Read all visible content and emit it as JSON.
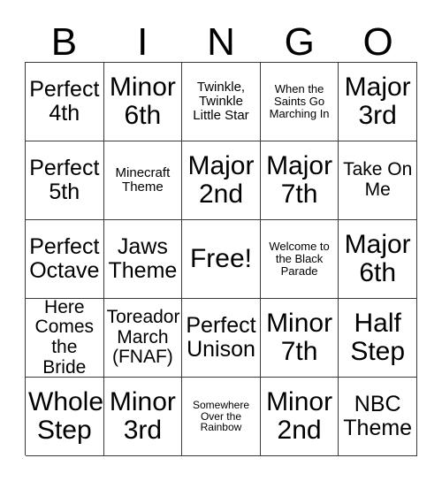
{
  "header": {
    "letters": [
      "B",
      "I",
      "N",
      "G",
      "O"
    ]
  },
  "grid": {
    "columns": 5,
    "rows": 5,
    "cells": [
      [
        {
          "text": "Perfect 4th",
          "size": "lg"
        },
        {
          "text": "Minor 6th",
          "size": "xl"
        },
        {
          "text": "Twinkle, Twinkle Little Star",
          "size": "sm"
        },
        {
          "text": "When the Saints Go Marching In",
          "size": "xs"
        },
        {
          "text": "Major 3rd",
          "size": "xl"
        }
      ],
      [
        {
          "text": "Perfect 5th",
          "size": "lg"
        },
        {
          "text": "Minecraft Theme",
          "size": "sm"
        },
        {
          "text": "Major 2nd",
          "size": "xl"
        },
        {
          "text": "Major 7th",
          "size": "xl"
        },
        {
          "text": "Take On Me",
          "size": "md"
        }
      ],
      [
        {
          "text": "Perfect Octave",
          "size": "lg"
        },
        {
          "text": "Jaws Theme",
          "size": "lg"
        },
        {
          "text": "Free!",
          "size": "xl"
        },
        {
          "text": "Welcome to the Black Parade",
          "size": "xs"
        },
        {
          "text": "Major 6th",
          "size": "xl"
        }
      ],
      [
        {
          "text": "Here Comes the Bride",
          "size": "md"
        },
        {
          "text": "Toreador March (FNAF)",
          "size": "md"
        },
        {
          "text": "Perfect Unison",
          "size": "lg"
        },
        {
          "text": "Minor 7th",
          "size": "xl"
        },
        {
          "text": "Half Step",
          "size": "xl"
        }
      ],
      [
        {
          "text": "Whole Step",
          "size": "xl"
        },
        {
          "text": "Minor 3rd",
          "size": "xl"
        },
        {
          "text": "Somewhere Over the Rainbow",
          "size": "xxs"
        },
        {
          "text": "Minor 2nd",
          "size": "xl"
        },
        {
          "text": "NBC Theme",
          "size": "lg"
        }
      ]
    ]
  },
  "colors": {
    "text": "#000000",
    "gridline": "#3a3a3a",
    "background": "#ffffff"
  }
}
